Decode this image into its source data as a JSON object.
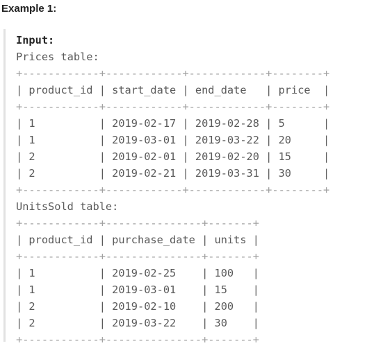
{
  "heading": "Example 1:",
  "input_label": "Input:",
  "prices": {
    "caption": "Prices table:",
    "border": "+------------+------------+------------+--------+",
    "header": "| product_id | start_date | end_date   | price  |",
    "rows": [
      "| 1          | 2019-02-17 | 2019-02-28 | 5      |",
      "| 1          | 2019-03-01 | 2019-03-22 | 20     |",
      "| 2          | 2019-02-01 | 2019-02-20 | 15     |",
      "| 2          | 2019-02-21 | 2019-03-31 | 30     |"
    ]
  },
  "units_sold": {
    "caption": "UnitsSold table:",
    "border": "+------------+---------------+-------+",
    "header": "| product_id | purchase_date | units |",
    "rows": [
      "| 1          | 2019-02-25    | 100   |",
      "| 1          | 2019-03-01    | 15    |",
      "| 2          | 2019-02-10    | 200   |",
      "| 2          | 2019-03-22    | 30    |"
    ]
  }
}
